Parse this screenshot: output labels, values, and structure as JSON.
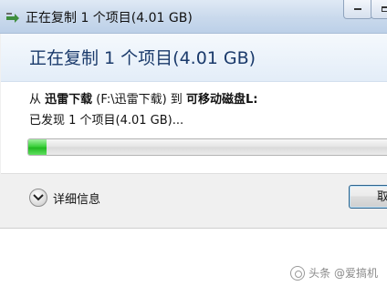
{
  "window": {
    "title": "正在复制 1 个项目(4.01 GB)"
  },
  "dialog": {
    "header": "正在复制 1 个项目(4.01 GB)",
    "from_prefix": "从 ",
    "source_name": "迅雷下载",
    "source_path": " (F:\\迅雷下载) 到 ",
    "dest_name": "可移动磁盘L:",
    "found_text": "已发现 1 个项目(4.01 GB)...",
    "progress_fraction": 0.05,
    "details_label": "详细信息",
    "cancel_label": "取消"
  },
  "watermark": {
    "text": "头条 @爱搞机"
  },
  "colors": {
    "progress_green": "#2fc52f",
    "header_text": "#1a3a6b"
  }
}
